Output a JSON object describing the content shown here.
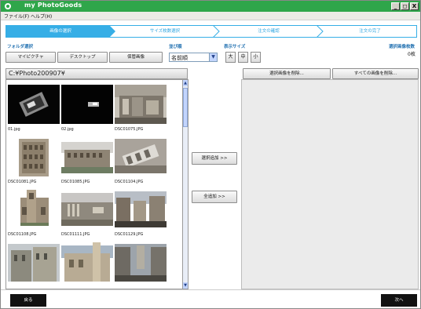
{
  "window": {
    "title": "my PhotoGoods",
    "min": "_",
    "max": "◻",
    "close": "X"
  },
  "menu": {
    "file": "ファイル(F)",
    "help": "ヘルプ(H)"
  },
  "steps": [
    {
      "label": "画像の選択",
      "active": true
    },
    {
      "label": "サイズ枚数選択",
      "active": false
    },
    {
      "label": "注文の確認",
      "active": false
    },
    {
      "label": "注文の完了",
      "active": false
    }
  ],
  "folder": {
    "label": "フォルダ選択",
    "buttons": [
      "マイピクチャ",
      "デスクトップ",
      "保管画像"
    ],
    "path": "C:¥Photo200907¥"
  },
  "sort": {
    "label": "並び順",
    "selected": "名前順"
  },
  "display_size": {
    "label": "表示サイズ",
    "options": [
      "大",
      "中",
      "小"
    ]
  },
  "selected_count": {
    "label": "選択画像枚数",
    "value": "0枚"
  },
  "thumbnails": [
    {
      "name": "01.jpg",
      "kind": "dark1"
    },
    {
      "name": "02.jpg",
      "kind": "dark2"
    },
    {
      "name": "DSC01075.JPG",
      "kind": "ruins1"
    },
    {
      "name": "DSC01081.JPG",
      "kind": "colosseum1"
    },
    {
      "name": "DSC01085.JPG",
      "kind": "colosseum2"
    },
    {
      "name": "DSC01104.JPG",
      "kind": "ruins2"
    },
    {
      "name": "DSC01108.JPG",
      "kind": "tower1"
    },
    {
      "name": "DSC01111.JPG",
      "kind": "forum"
    },
    {
      "name": "DSC01129.JPG",
      "kind": "street1"
    },
    {
      "name": "",
      "kind": "cathedral"
    },
    {
      "name": "",
      "kind": "duomo"
    },
    {
      "name": "",
      "kind": "street2"
    }
  ],
  "actions": {
    "add_selected": "選択追加 >>",
    "add_all": "全追加 >>"
  },
  "right_buttons": {
    "remove_selected": "選択画像を削除...",
    "remove_all": "すべての画像を削除..."
  },
  "nav": {
    "back": "戻る",
    "next": "次へ"
  },
  "colors": {
    "title_green": "#2fa64a",
    "step_blue": "#36aee6",
    "label_blue": "#1f6fb0"
  }
}
